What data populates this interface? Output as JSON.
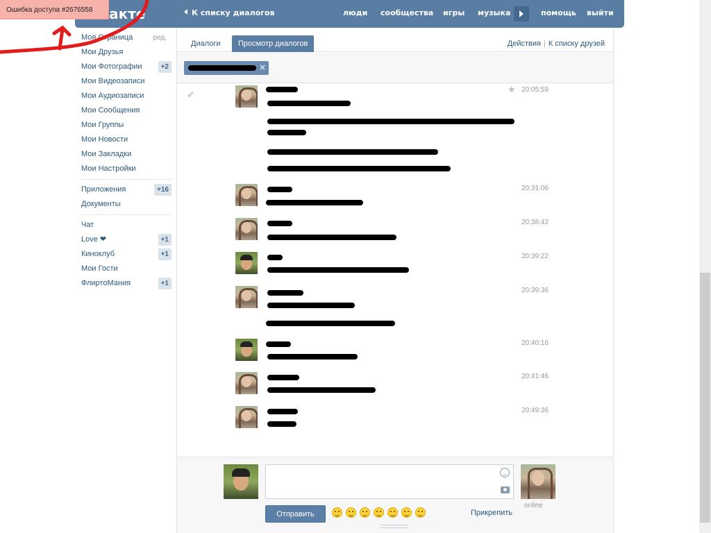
{
  "error_toast": "Ошибка доступа #2676558",
  "header": {
    "logo_text": "онтакте",
    "back_link": "К списку диалогов",
    "nav": [
      "люди",
      "сообщества",
      "игры",
      "музыка",
      "помощь",
      "выйти"
    ]
  },
  "sidebar": {
    "edit_label": "ред.",
    "items": [
      {
        "label": "Моя Страница",
        "badge": ""
      },
      {
        "label": "Мои Друзья",
        "badge": ""
      },
      {
        "label": "Мои Фотографии",
        "badge": "+2"
      },
      {
        "label": "Мои Видеозаписи",
        "badge": ""
      },
      {
        "label": "Мои Аудиозаписи",
        "badge": ""
      },
      {
        "label": "Мои Сообщения",
        "badge": ""
      },
      {
        "label": "Мои Группы",
        "badge": ""
      },
      {
        "label": "Мои Новости",
        "badge": ""
      },
      {
        "label": "Мои Закладки",
        "badge": ""
      },
      {
        "label": "Мои Настройки",
        "badge": ""
      }
    ],
    "items2": [
      {
        "label": "Приложения",
        "badge": "+16"
      },
      {
        "label": "Документы",
        "badge": ""
      }
    ],
    "items3": [
      {
        "label": "Чат",
        "badge": ""
      },
      {
        "label": "Love ❤",
        "badge": "+1"
      },
      {
        "label": "Киноклуб",
        "badge": "+1"
      },
      {
        "label": "Мои Гости",
        "badge": ""
      },
      {
        "label": "ФлиртоМания",
        "badge": "+1"
      }
    ]
  },
  "tabs": [
    "Диалоги",
    "Просмотр диалогов"
  ],
  "actions": {
    "actions_label": "Действия",
    "friends_label": "К списку друзей"
  },
  "messages": [
    {
      "time": "20:05:59",
      "author": "girl"
    },
    {
      "time": "20:31:06",
      "author": "girl"
    },
    {
      "time": "20:38:42",
      "author": "girl"
    },
    {
      "time": "20:39:22",
      "author": "boy"
    },
    {
      "time": "20:39:36",
      "author": "girl"
    },
    {
      "time": "20:40:16",
      "author": "boy"
    },
    {
      "time": "20:41:46",
      "author": "girl"
    },
    {
      "time": "20:49:36",
      "author": "girl"
    }
  ],
  "composer": {
    "send_label": "Отправить",
    "attach_label": "Прикрепить",
    "peer_status": "online"
  },
  "colors": {
    "brand": "#597da3",
    "link": "#2b587a",
    "toast": "#f7b3ab"
  }
}
